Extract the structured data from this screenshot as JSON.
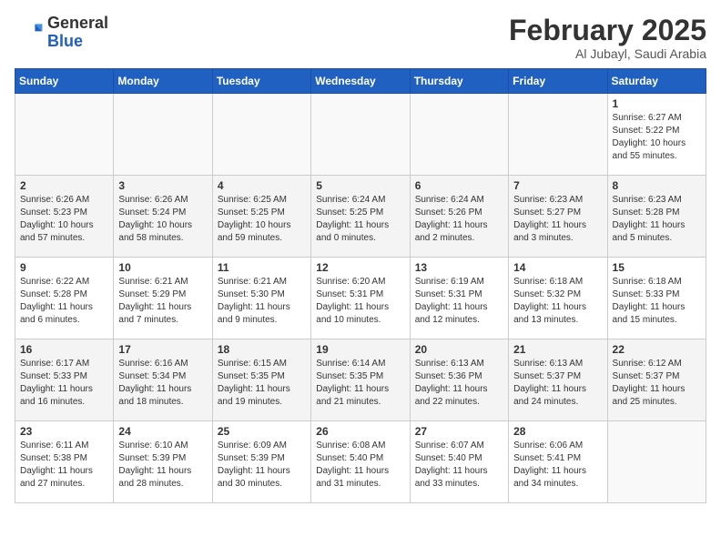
{
  "header": {
    "logo_general": "General",
    "logo_blue": "Blue",
    "month_year": "February 2025",
    "location": "Al Jubayl, Saudi Arabia"
  },
  "weekdays": [
    "Sunday",
    "Monday",
    "Tuesday",
    "Wednesday",
    "Thursday",
    "Friday",
    "Saturday"
  ],
  "weeks": [
    [
      {
        "day": "",
        "info": ""
      },
      {
        "day": "",
        "info": ""
      },
      {
        "day": "",
        "info": ""
      },
      {
        "day": "",
        "info": ""
      },
      {
        "day": "",
        "info": ""
      },
      {
        "day": "",
        "info": ""
      },
      {
        "day": "1",
        "info": "Sunrise: 6:27 AM\nSunset: 5:22 PM\nDaylight: 10 hours\nand 55 minutes."
      }
    ],
    [
      {
        "day": "2",
        "info": "Sunrise: 6:26 AM\nSunset: 5:23 PM\nDaylight: 10 hours\nand 57 minutes."
      },
      {
        "day": "3",
        "info": "Sunrise: 6:26 AM\nSunset: 5:24 PM\nDaylight: 10 hours\nand 58 minutes."
      },
      {
        "day": "4",
        "info": "Sunrise: 6:25 AM\nSunset: 5:25 PM\nDaylight: 10 hours\nand 59 minutes."
      },
      {
        "day": "5",
        "info": "Sunrise: 6:24 AM\nSunset: 5:25 PM\nDaylight: 11 hours\nand 0 minutes."
      },
      {
        "day": "6",
        "info": "Sunrise: 6:24 AM\nSunset: 5:26 PM\nDaylight: 11 hours\nand 2 minutes."
      },
      {
        "day": "7",
        "info": "Sunrise: 6:23 AM\nSunset: 5:27 PM\nDaylight: 11 hours\nand 3 minutes."
      },
      {
        "day": "8",
        "info": "Sunrise: 6:23 AM\nSunset: 5:28 PM\nDaylight: 11 hours\nand 5 minutes."
      }
    ],
    [
      {
        "day": "9",
        "info": "Sunrise: 6:22 AM\nSunset: 5:28 PM\nDaylight: 11 hours\nand 6 minutes."
      },
      {
        "day": "10",
        "info": "Sunrise: 6:21 AM\nSunset: 5:29 PM\nDaylight: 11 hours\nand 7 minutes."
      },
      {
        "day": "11",
        "info": "Sunrise: 6:21 AM\nSunset: 5:30 PM\nDaylight: 11 hours\nand 9 minutes."
      },
      {
        "day": "12",
        "info": "Sunrise: 6:20 AM\nSunset: 5:31 PM\nDaylight: 11 hours\nand 10 minutes."
      },
      {
        "day": "13",
        "info": "Sunrise: 6:19 AM\nSunset: 5:31 PM\nDaylight: 11 hours\nand 12 minutes."
      },
      {
        "day": "14",
        "info": "Sunrise: 6:18 AM\nSunset: 5:32 PM\nDaylight: 11 hours\nand 13 minutes."
      },
      {
        "day": "15",
        "info": "Sunrise: 6:18 AM\nSunset: 5:33 PM\nDaylight: 11 hours\nand 15 minutes."
      }
    ],
    [
      {
        "day": "16",
        "info": "Sunrise: 6:17 AM\nSunset: 5:33 PM\nDaylight: 11 hours\nand 16 minutes."
      },
      {
        "day": "17",
        "info": "Sunrise: 6:16 AM\nSunset: 5:34 PM\nDaylight: 11 hours\nand 18 minutes."
      },
      {
        "day": "18",
        "info": "Sunrise: 6:15 AM\nSunset: 5:35 PM\nDaylight: 11 hours\nand 19 minutes."
      },
      {
        "day": "19",
        "info": "Sunrise: 6:14 AM\nSunset: 5:35 PM\nDaylight: 11 hours\nand 21 minutes."
      },
      {
        "day": "20",
        "info": "Sunrise: 6:13 AM\nSunset: 5:36 PM\nDaylight: 11 hours\nand 22 minutes."
      },
      {
        "day": "21",
        "info": "Sunrise: 6:13 AM\nSunset: 5:37 PM\nDaylight: 11 hours\nand 24 minutes."
      },
      {
        "day": "22",
        "info": "Sunrise: 6:12 AM\nSunset: 5:37 PM\nDaylight: 11 hours\nand 25 minutes."
      }
    ],
    [
      {
        "day": "23",
        "info": "Sunrise: 6:11 AM\nSunset: 5:38 PM\nDaylight: 11 hours\nand 27 minutes."
      },
      {
        "day": "24",
        "info": "Sunrise: 6:10 AM\nSunset: 5:39 PM\nDaylight: 11 hours\nand 28 minutes."
      },
      {
        "day": "25",
        "info": "Sunrise: 6:09 AM\nSunset: 5:39 PM\nDaylight: 11 hours\nand 30 minutes."
      },
      {
        "day": "26",
        "info": "Sunrise: 6:08 AM\nSunset: 5:40 PM\nDaylight: 11 hours\nand 31 minutes."
      },
      {
        "day": "27",
        "info": "Sunrise: 6:07 AM\nSunset: 5:40 PM\nDaylight: 11 hours\nand 33 minutes."
      },
      {
        "day": "28",
        "info": "Sunrise: 6:06 AM\nSunset: 5:41 PM\nDaylight: 11 hours\nand 34 minutes."
      },
      {
        "day": "",
        "info": ""
      }
    ]
  ]
}
